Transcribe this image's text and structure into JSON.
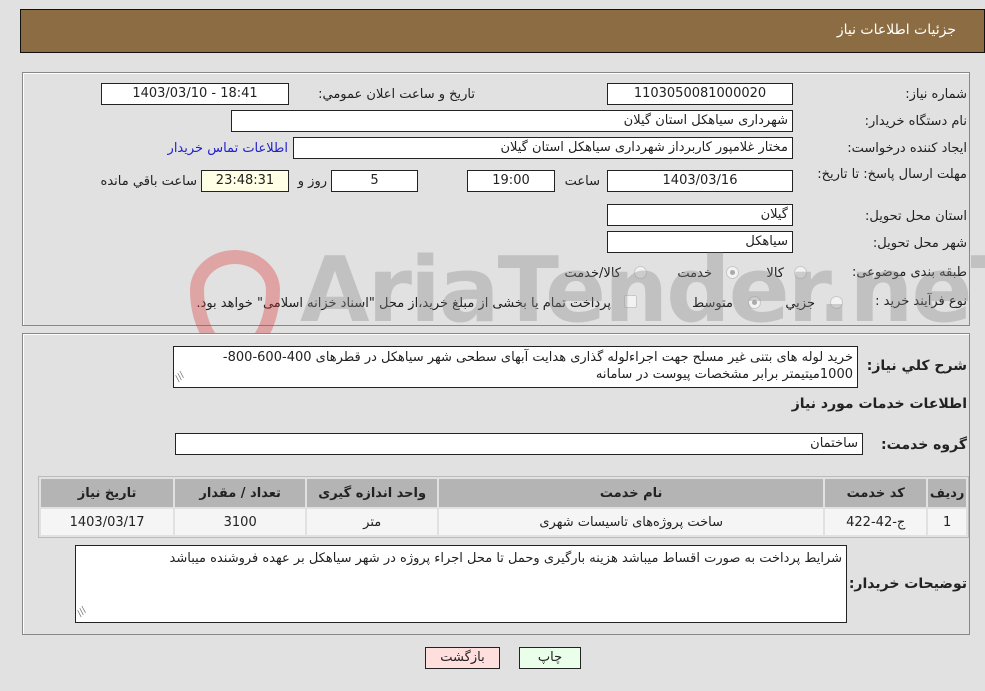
{
  "header": {
    "title": "جزئیات اطلاعات نیاز"
  },
  "details": {
    "need_number_label": "شماره نیاز:",
    "need_number": "1103050081000020",
    "announce_label": "تاریخ و ساعت اعلان عمومي:",
    "announce_value": "1403/03/10 - 18:41",
    "buyer_org_label": "نام دستگاه خریدار:",
    "buyer_org": "شهرداری سیاهکل استان گیلان",
    "creator_label": "ایجاد کننده درخواست:",
    "creator": "مختار غلامپور کاربرداز شهرداری سیاهکل استان گیلان",
    "contact_link": "اطلاعات تماس خریدار",
    "deadline_label": "مهلت ارسال پاسخ: تا تاریخ:",
    "deadline_date": "1403/03/16",
    "time_label": "ساعت",
    "deadline_time": "19:00",
    "days_value": "5",
    "days_label": "روز و",
    "remaining_time": "23:48:31",
    "remaining_label": "ساعت باقي مانده",
    "province_label": "استان محل تحویل:",
    "province": "گیلان",
    "city_label": "شهر محل تحویل:",
    "city": "سیاهکل",
    "category_label": "طبقه بندی موضوعی:",
    "category_options": [
      {
        "label": "کالا",
        "checked": false
      },
      {
        "label": "خدمت",
        "checked": true
      },
      {
        "label": "کالا/خدمت",
        "checked": false
      }
    ],
    "process_label": "نوع فرآیند خرید :",
    "process_options": [
      {
        "label": "جزیي",
        "checked": false
      },
      {
        "label": "متوسط",
        "checked": true
      }
    ],
    "treasury_note": "پرداخت تمام یا بخشی از مبلغ خرید،از محل \"اسناد خزانه اسلامی\" خواهد بود.",
    "treasury_checked": false
  },
  "description": {
    "label": "شرح کلي نیاز:",
    "text": "خرید لوله های بتنی غیر مسلح جهت اجراءلوله گذاری هدایت آبهای سطحی شهر سیاهکل در قطرهای 400-600-800-1000میتیمتر برابر مشخصات پیوست در سامانه"
  },
  "services": {
    "section_title": "اطلاعات خدمات مورد نیاز",
    "group_label": "گروه خدمت:",
    "group_value": "ساختمان",
    "columns": [
      "ردیف",
      "کد خدمت",
      "نام خدمت",
      "واحد اندازه گیری",
      "تعداد / مقدار",
      "تاریخ نیاز"
    ],
    "rows": [
      [
        "1",
        "ج-42-422",
        "ساخت پروژه‌های تاسیسات شهری",
        "متر",
        "3100",
        "1403/03/17"
      ]
    ]
  },
  "buyer_notes": {
    "label": "توضیحات خریدار:",
    "text": "شرایط پرداخت به صورت اقساط میباشد هزینه بارگیری وحمل تا محل اجراء پروژه در شهر سیاهکل بر عهده فروشنده میباشد"
  },
  "buttons": {
    "print": "چاپ",
    "back": "بازگشت"
  },
  "watermark": {
    "text": "AriaTender.neT"
  },
  "colors": {
    "header_bg": "#8c6d43",
    "link": "#2222cc",
    "print_bg": "#eaffea",
    "back_bg": "#ffdede",
    "remaining_bg": "#ffffe6"
  }
}
